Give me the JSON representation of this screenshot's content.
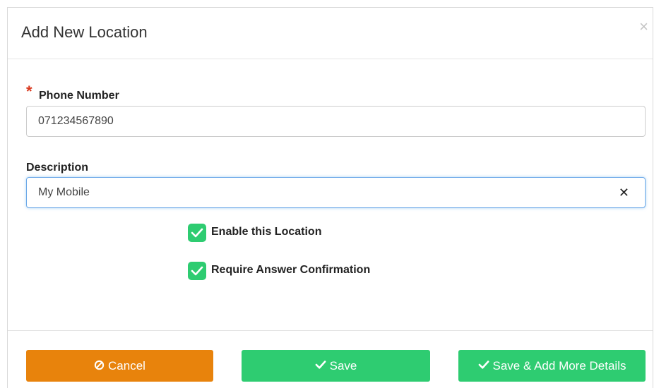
{
  "dialog": {
    "title": "Add New Location",
    "close_glyph": "×"
  },
  "phone": {
    "required_marker": "*",
    "label": "Phone Number",
    "value": "071234567890"
  },
  "description": {
    "label": "Description",
    "value": "My Mobile",
    "clear_glyph": "✕"
  },
  "options": {
    "enable_label": "Enable this Location",
    "enable_checked": true,
    "confirm_label": "Require Answer Confirmation",
    "confirm_checked": true
  },
  "buttons": {
    "cancel_label": "Cancel",
    "cancel_icon": "ban-icon",
    "save_label": "Save",
    "save_icon": "check-icon",
    "save_more_label": "Save & Add More Details",
    "save_more_icon": "check-icon"
  },
  "colors": {
    "cancel": "#e8830c",
    "save": "#2ecc71",
    "checkbox": "#2ecc71",
    "required": "#d9381e"
  }
}
